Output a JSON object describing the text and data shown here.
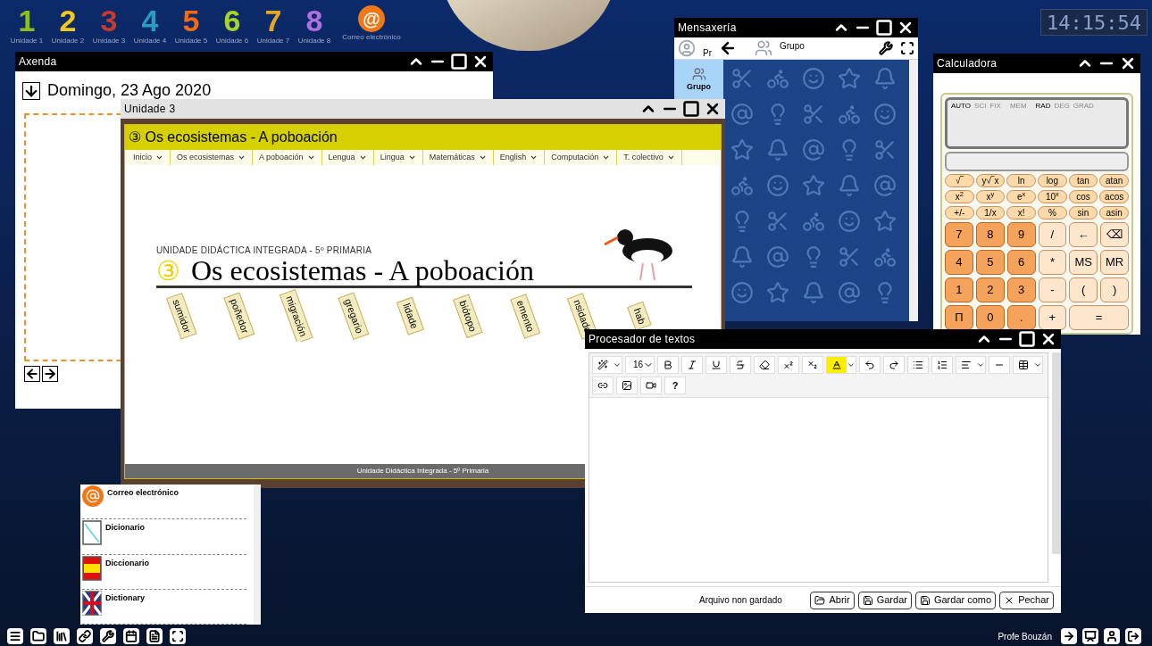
{
  "desktop_icons": [
    {
      "kind": "number",
      "symbol": "1",
      "caption": "Unidade 1",
      "color": "#8cbf1a"
    },
    {
      "kind": "number",
      "symbol": "2",
      "caption": "Unidade 2",
      "color": "#f2c81c"
    },
    {
      "kind": "number",
      "symbol": "3",
      "caption": "Unidade 3",
      "color": "#c63a30"
    },
    {
      "kind": "number",
      "symbol": "4",
      "caption": "Unidade 4",
      "color": "#2a9bc0"
    },
    {
      "kind": "number",
      "symbol": "5",
      "caption": "Unidade 5",
      "color": "#f26a12"
    },
    {
      "kind": "number",
      "symbol": "6",
      "caption": "Unidade 6",
      "color": "#a6d22a"
    },
    {
      "kind": "number",
      "symbol": "7",
      "caption": "Unidade 7",
      "color": "#e3a823"
    },
    {
      "kind": "number",
      "symbol": "8",
      "caption": "Unidade 8",
      "color": "#b070e0"
    },
    {
      "kind": "mail",
      "symbol": "@",
      "caption": "Correo electrónico",
      "color": "#f07818"
    }
  ],
  "clock": "14:15:54",
  "agenda": {
    "title": "Axenda",
    "date": "Domingo, 23 Ago 2020"
  },
  "unit": {
    "title": "Unidade 3",
    "header": "③ Os ecosistemas - A poboación",
    "menu": [
      {
        "label": "Inicio"
      },
      {
        "label": "Os ecosistemas"
      },
      {
        "label": "A poboación"
      },
      {
        "label": "Lengua"
      },
      {
        "label": "Lingua"
      },
      {
        "label": "Matemáticas"
      },
      {
        "label": "English"
      },
      {
        "label": "Computación"
      },
      {
        "label": "T. colectivo"
      }
    ],
    "banner": {
      "subtitle": "UNIDADE DIDÁCTICA INTEGRADA - 5º PRIMARIA",
      "number": "③",
      "title": "Os ecosistemas - A poboación",
      "tags": [
        "sumidor",
        "poñedor",
        "migración",
        "gregario",
        "lidade",
        "biótopo",
        "emento",
        "nsidade",
        "hab"
      ]
    },
    "footer": "Unidade Didáctica Integrada - 5º Primaria"
  },
  "messaging": {
    "title": "Mensaxería",
    "user": "Pr",
    "chat": "Grupo",
    "contacts": [
      {
        "label": "Grupo",
        "selected": true
      }
    ]
  },
  "calculator": {
    "title": "Calculadora",
    "indicators": [
      {
        "label": "AUTO",
        "on": true
      },
      {
        "label": "SCI",
        "on": false
      },
      {
        "label": "FIX",
        "on": false
      },
      {
        "label": "MEM",
        "on": false
      },
      {
        "label": "RAD",
        "on": true
      },
      {
        "label": "DEG",
        "on": false
      },
      {
        "label": "GRAD",
        "on": false
      }
    ],
    "function_keys": [
      [
        "√‾",
        "y√‾x",
        "ln",
        "log",
        "tan",
        "atan"
      ],
      [
        "x$^{2}$",
        "x$^{y}$",
        "e$^{x}$",
        "10$^{x}$",
        "cos",
        "acos"
      ],
      [
        "+/-",
        "1/x",
        "x!",
        "%",
        "sin",
        "asin"
      ]
    ],
    "keys": [
      [
        {
          "label": "7",
          "kind": "digit"
        },
        {
          "label": "8",
          "kind": "digit"
        },
        {
          "label": "9",
          "kind": "digit"
        },
        {
          "label": "/",
          "kind": "operator"
        },
        {
          "label": "←",
          "kind": "operator"
        },
        {
          "label": "⌫",
          "kind": "operator"
        }
      ],
      [
        {
          "label": "4",
          "kind": "digit"
        },
        {
          "label": "5",
          "kind": "digit"
        },
        {
          "label": "6",
          "kind": "digit"
        },
        {
          "label": "*",
          "kind": "operator"
        },
        {
          "label": "MS",
          "kind": "operator"
        },
        {
          "label": "MR",
          "kind": "operator"
        }
      ],
      [
        {
          "label": "1",
          "kind": "digit"
        },
        {
          "label": "2",
          "kind": "digit"
        },
        {
          "label": "3",
          "kind": "digit"
        },
        {
          "label": "-",
          "kind": "operator"
        },
        {
          "label": "(",
          "kind": "operator"
        },
        {
          "label": ")",
          "kind": "operator"
        }
      ],
      [
        {
          "label": "Π",
          "kind": "digit"
        },
        {
          "label": "0",
          "kind": "digit"
        },
        {
          "label": ".",
          "kind": "digit"
        },
        {
          "label": "+",
          "kind": "operator"
        },
        {
          "label": "=",
          "kind": "wide"
        }
      ]
    ]
  },
  "word_processor": {
    "title": "Procesador de textos",
    "font_size": "16",
    "help": "?",
    "status": "Arquivo non gardado",
    "buttons": [
      {
        "label": "Abrir",
        "kind": "open"
      },
      {
        "label": "Gardar",
        "kind": "save"
      },
      {
        "label": "Gardar como",
        "kind": "save"
      },
      {
        "label": "Pechar",
        "kind": "close"
      }
    ]
  },
  "launcher": {
    "items": [
      {
        "label": "Correo electrónico",
        "kind": "mail"
      },
      {
        "label": "Dicionario",
        "kind": "book"
      },
      {
        "label": "Diccionario",
        "kind": "spain"
      },
      {
        "label": "Dictionary",
        "kind": "uk"
      }
    ]
  },
  "taskbar": {
    "user": "Profe Bouzán"
  }
}
